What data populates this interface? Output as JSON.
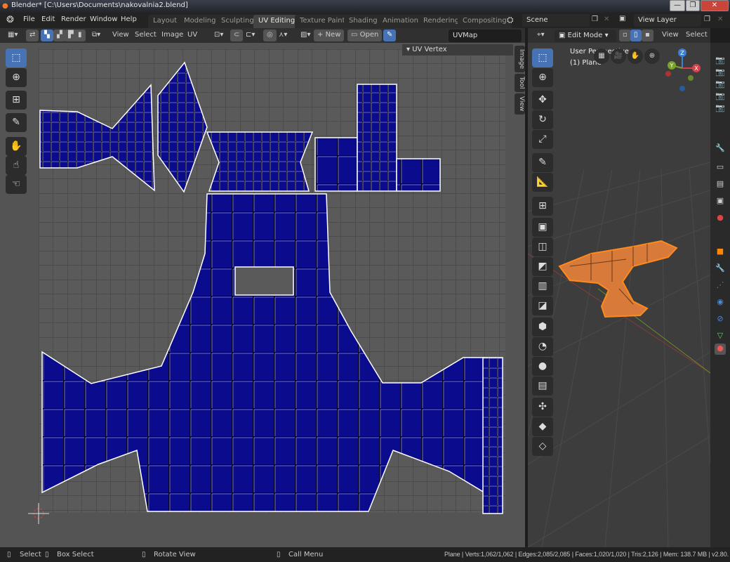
{
  "window": {
    "title": "Blender* [C:\\Users\\Documents\\nakovalnia2.blend]",
    "minimize": "—",
    "maximize": "❐",
    "close": "✕"
  },
  "menus": [
    "File",
    "Edit",
    "Render",
    "Window",
    "Help"
  ],
  "workspaces": [
    "Layout",
    "Modeling",
    "Sculpting",
    "UV Editing",
    "Texture Paint",
    "Shading",
    "Animation",
    "Rendering",
    "Compositing"
  ],
  "active_workspace": "UV Editing",
  "scene": "Scene",
  "view_layer": "View Layer",
  "uv_header": {
    "view": "View",
    "select": "Select",
    "image": "Image",
    "uv": "UV",
    "new": "New",
    "open": "Open",
    "uvmap": "UVMap"
  },
  "uv_panel": {
    "title": "UV Vertex"
  },
  "side_tabs": [
    "Image",
    "Tool",
    "View"
  ],
  "viewport_header": {
    "mode": "Edit Mode",
    "view": "View",
    "select": "Select"
  },
  "viewport_overlay": {
    "perspective": "User Perspective",
    "object": "(1) Plane"
  },
  "gizmo": {
    "x": "X",
    "y": "Y",
    "z": "Z"
  },
  "colors": {
    "accent": "#4772b3",
    "uv_face": "#0b0b8e",
    "mesh_select": "#ff8a1c"
  },
  "status": {
    "select": "Select",
    "box_select": "Box Select",
    "rotate": "Rotate View",
    "call_menu": "Call Menu",
    "stats": "Plane | Verts:1,062/1,062 | Edges:2,085/2,085 | Faces:1,020/1,020 | Tris:2,126 | Mem: 138.7 MB | v2.80."
  }
}
